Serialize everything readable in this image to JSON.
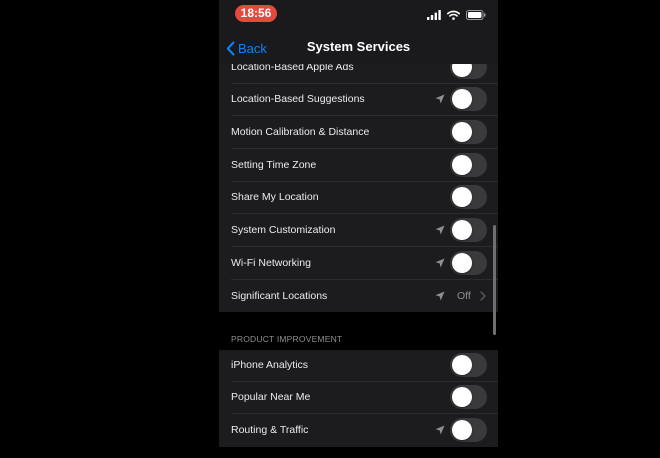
{
  "status_bar": {
    "time": "18:56"
  },
  "nav": {
    "back_label": "Back",
    "title": "System Services"
  },
  "location_services": [
    {
      "label": "Location-Based Apple Ads",
      "enabled": false,
      "location_arrow": false
    },
    {
      "label": "Location-Based Suggestions",
      "enabled": false,
      "location_arrow": true
    },
    {
      "label": "Motion Calibration & Distance",
      "enabled": false,
      "location_arrow": false
    },
    {
      "label": "Setting Time Zone",
      "enabled": false,
      "location_arrow": false
    },
    {
      "label": "Share My Location",
      "enabled": false,
      "location_arrow": false
    },
    {
      "label": "System Customization",
      "enabled": false,
      "location_arrow": true
    },
    {
      "label": "Wi-Fi Networking",
      "enabled": false,
      "location_arrow": true
    }
  ],
  "significant_locations": {
    "label": "Significant Locations",
    "value": "Off"
  },
  "product_improvement": {
    "header": "PRODUCT IMPROVEMENT",
    "items": [
      {
        "label": "iPhone Analytics",
        "enabled": false,
        "location_arrow": false
      },
      {
        "label": "Popular Near Me",
        "enabled": false,
        "location_arrow": false
      },
      {
        "label": "Routing & Traffic",
        "enabled": false,
        "location_arrow": true
      }
    ]
  },
  "colors": {
    "accent": "#0a84ff",
    "time_pill": "#e5483c",
    "group_background": "#1c1c1e",
    "toggle_off": "#3a3a3c",
    "secondary_text": "#8e8e93"
  },
  "icons": {
    "signal": "cellular-signal-icon",
    "wifi": "wifi-icon",
    "battery": "battery-icon",
    "back": "chevron-left-icon",
    "location": "location-arrow-icon",
    "disclosure": "chevron-right-icon"
  }
}
